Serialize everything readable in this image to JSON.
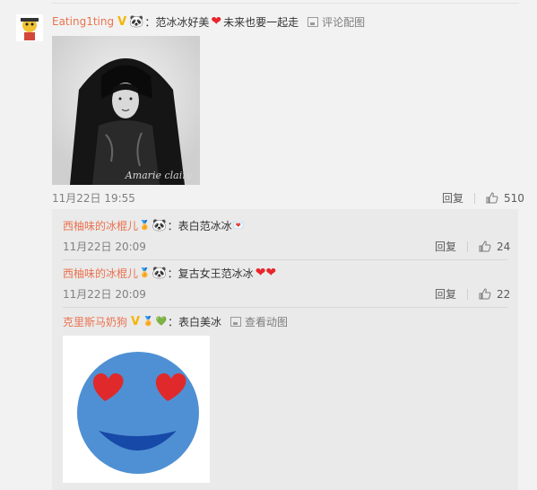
{
  "comment": {
    "username": "Eating1ting",
    "separator": "：",
    "text_a": "范冰冰好美",
    "text_b": "未来也要一起走",
    "pic_link": "评论配图",
    "image_caption": "Amarie claire",
    "date": "11月22日 19:55",
    "reply": "回复",
    "likes": "510"
  },
  "replies": [
    {
      "username": "西柚味的冰棍儿",
      "separator": "：",
      "text": "表白范冰冰",
      "date": "11月22日 20:09",
      "reply": "回复",
      "likes": "24"
    },
    {
      "username": "西柚味的冰棍儿",
      "separator": "：",
      "text": "复古女王范冰冰",
      "date": "11月22日 20:09",
      "reply": "回复",
      "likes": "22"
    },
    {
      "username": "克里斯马奶狗",
      "separator": "：",
      "text": "表白美冰",
      "pic_link": "查看动图"
    }
  ],
  "colors": {
    "username": "#eb7350",
    "heart": "#e8262b",
    "vip": "#f6b400",
    "emoji_face": "#4f90d4",
    "emoji_mouth": "#1749a8"
  },
  "icons": [
    "vip-badge-icon",
    "panda-icon",
    "heart-icon",
    "picture-icon",
    "thumb-up-icon"
  ]
}
